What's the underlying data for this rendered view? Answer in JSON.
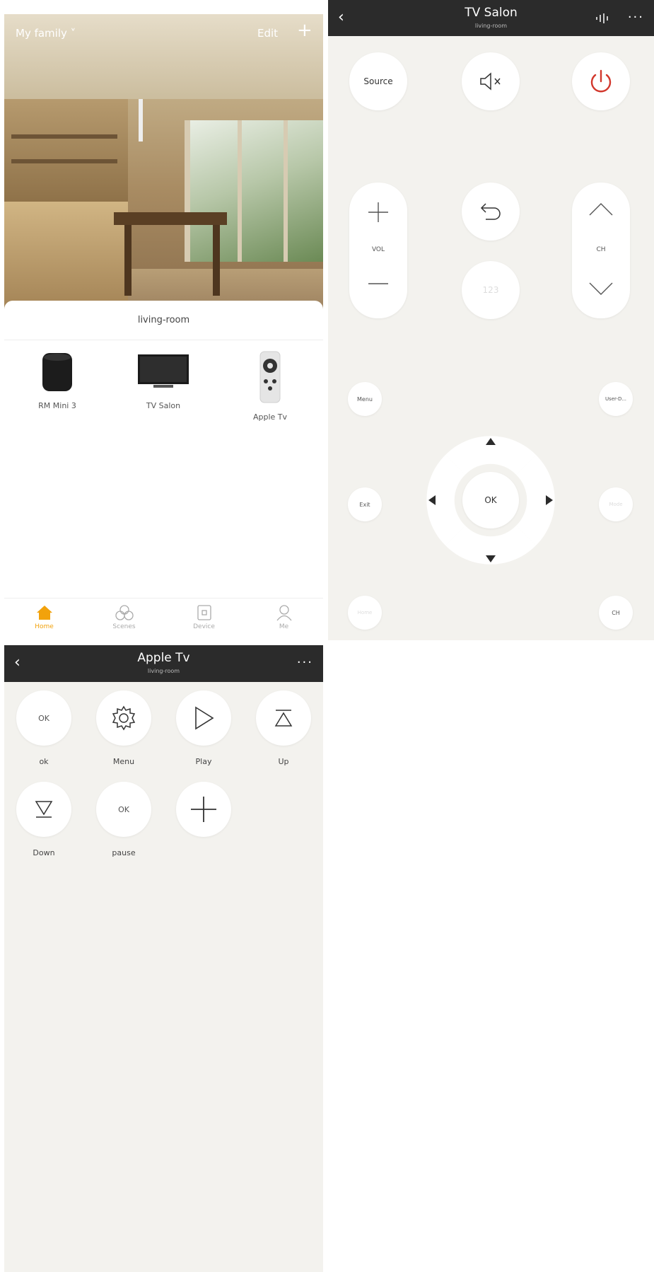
{
  "home": {
    "family_label": "My family ˅",
    "edit_label": "Edit",
    "add_label": "+",
    "room_name": "living-room",
    "devices": [
      {
        "label": "RM Mini 3",
        "icon": "rm-mini-hub-icon"
      },
      {
        "label": "TV Salon",
        "icon": "tv-icon"
      },
      {
        "label": "Apple Tv",
        "icon": "remote-control-icon"
      }
    ],
    "tabs": [
      {
        "label": "Home",
        "icon": "home-icon",
        "active": true
      },
      {
        "label": "Scenes",
        "icon": "scenes-icon",
        "active": false
      },
      {
        "label": "Device",
        "icon": "device-icon",
        "active": false
      },
      {
        "label": "Me",
        "icon": "person-icon",
        "active": false
      }
    ],
    "accent_color": "#f2a20c"
  },
  "tv": {
    "title": "TV Salon",
    "subtitle": "living-room",
    "source_label": "Source",
    "vol_label": "VOL",
    "ch_label": "CH",
    "num_label": "123",
    "menu_label": "Menu",
    "user_label": "User-D...",
    "exit_label": "Exit",
    "ok_label": "OK",
    "mode_label": "Mode",
    "bottom_left_label": "Home",
    "bottom_right_label": "CH",
    "power_color": "#d2372c"
  },
  "apple": {
    "title": "Apple Tv",
    "subtitle": "living-room",
    "keys": [
      {
        "inner": "OK",
        "label": "ok",
        "icon": ""
      },
      {
        "inner": "",
        "label": "Menu",
        "icon": "gear-icon"
      },
      {
        "inner": "",
        "label": "Play",
        "icon": "play-icon"
      },
      {
        "inner": "",
        "label": "Up",
        "icon": "up-icon"
      },
      {
        "inner": "",
        "label": "Down",
        "icon": "down-icon"
      },
      {
        "inner": "OK",
        "label": "pause",
        "icon": ""
      },
      {
        "inner": "",
        "label": "",
        "icon": "plus-icon"
      }
    ]
  }
}
